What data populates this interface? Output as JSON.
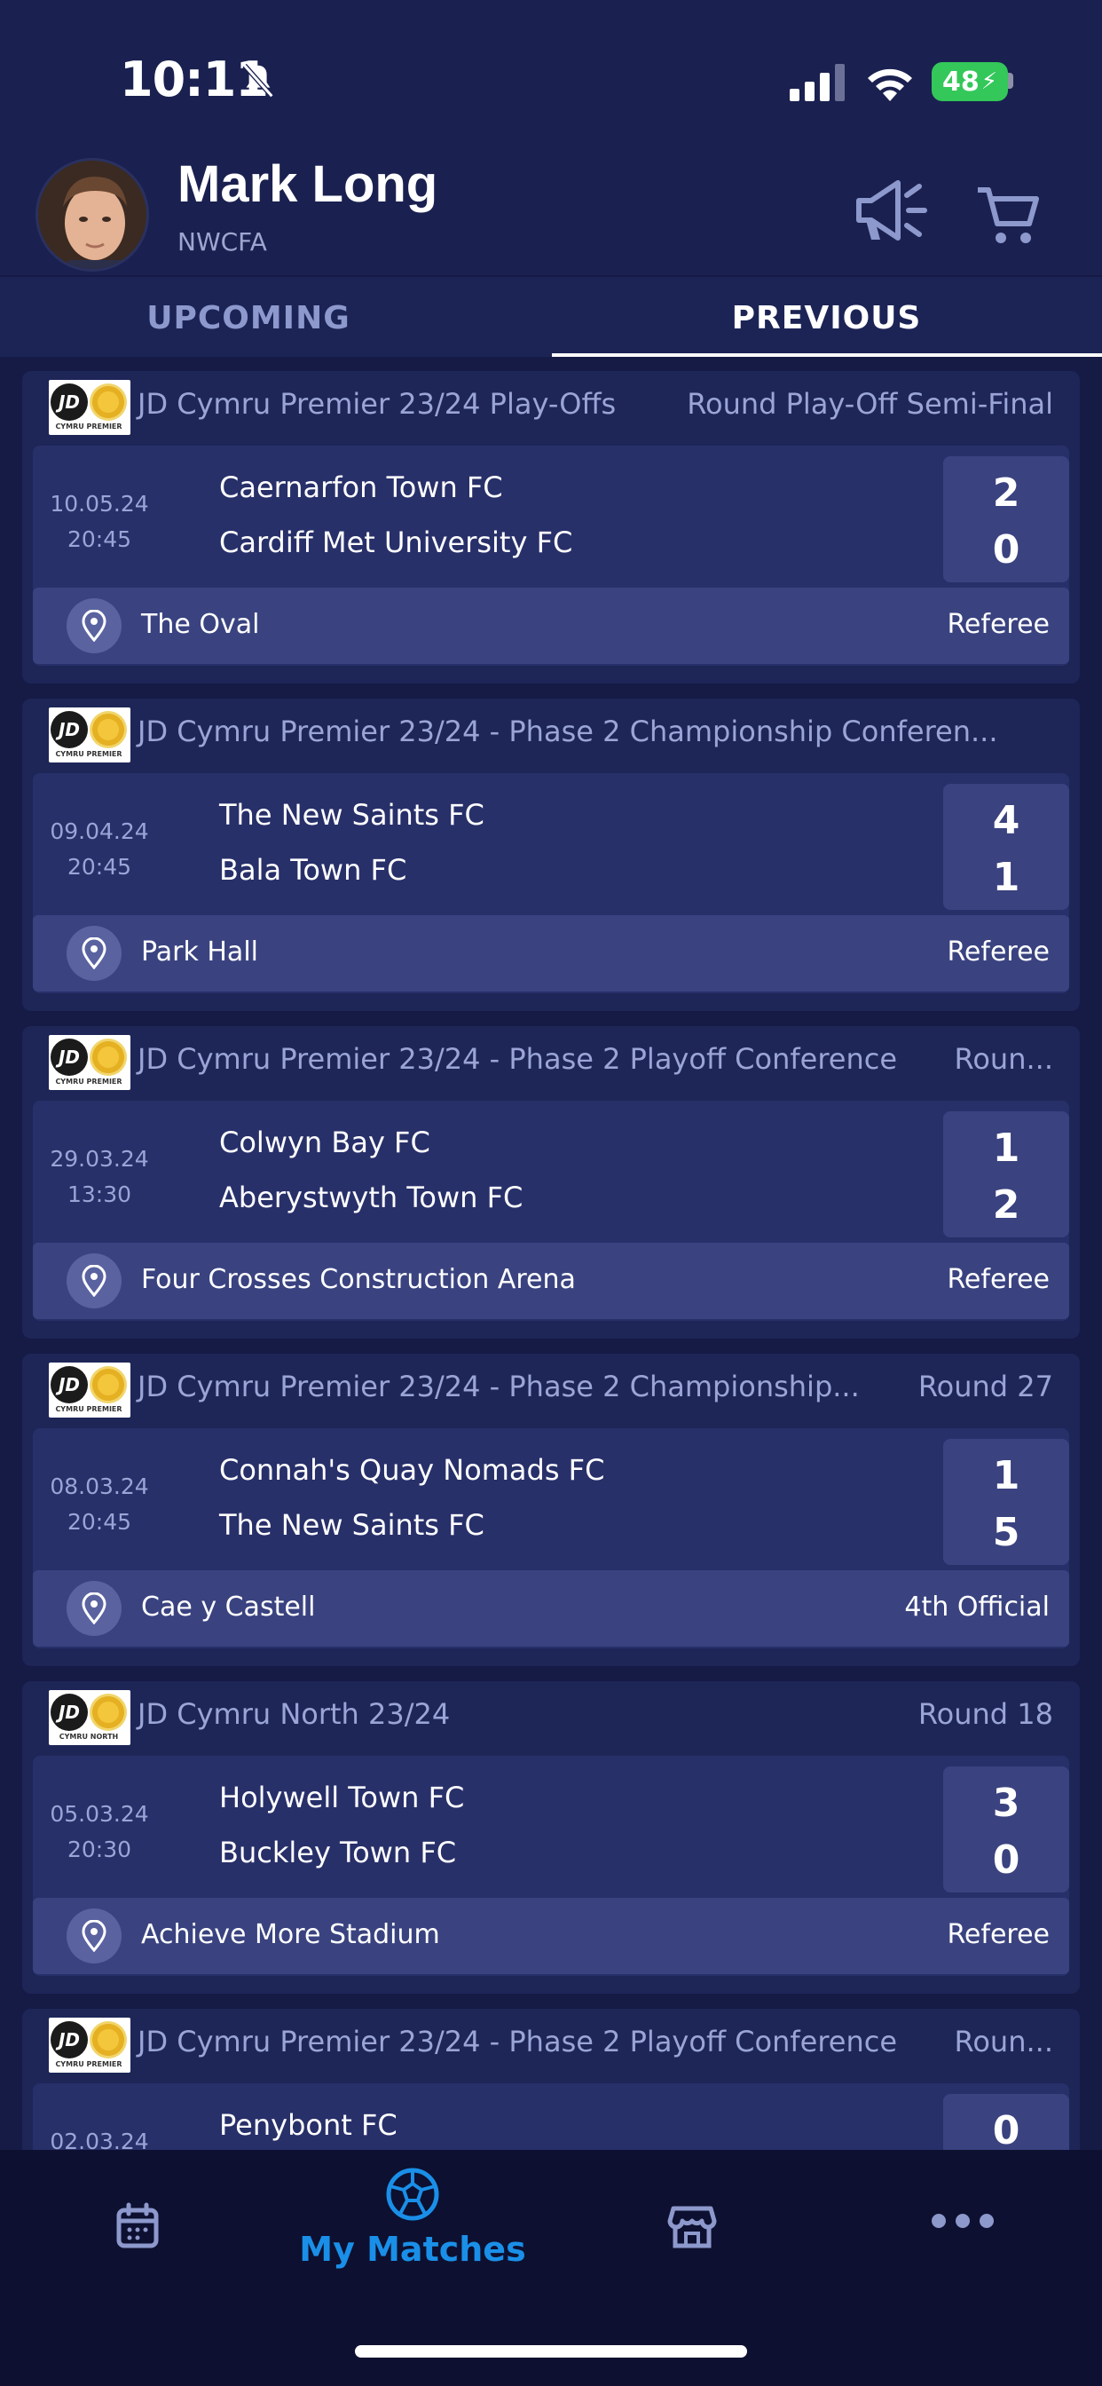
{
  "status_bar": {
    "time": "10:11",
    "battery": "48"
  },
  "header": {
    "user_name": "Mark Long",
    "organization": "NWCFA"
  },
  "tabs": [
    {
      "label": "UPCOMING",
      "active": false
    },
    {
      "label": "PREVIOUS",
      "active": true
    }
  ],
  "matches": [
    {
      "competition": "JD Cymru Premier 23/24 Play-Offs",
      "round": "Round Play-Off Semi-Final",
      "date": "10.05.24",
      "time": "20:45",
      "home_team": "Caernarfon Town FC",
      "away_team": "Cardiff Met University FC",
      "home_score": "2",
      "away_score": "0",
      "venue": "The Oval",
      "role": "Referee",
      "logo_sub": "CYMRU PREMIER"
    },
    {
      "competition": "JD Cymru Premier 23/24 - Phase 2 Championship Conferen...",
      "round": "",
      "date": "09.04.24",
      "time": "20:45",
      "home_team": "The New Saints FC",
      "away_team": "Bala Town FC",
      "home_score": "4",
      "away_score": "1",
      "venue": "Park Hall",
      "role": "Referee",
      "logo_sub": "CYMRU PREMIER"
    },
    {
      "competition": "JD Cymru Premier 23/24 - Phase 2 Playoff Conference",
      "round": "Roun...",
      "date": "29.03.24",
      "time": "13:30",
      "home_team": "Colwyn Bay FC",
      "away_team": "Aberystwyth Town FC",
      "home_score": "1",
      "away_score": "2",
      "venue": "Four Crosses Construction Arena",
      "role": "Referee",
      "logo_sub": "CYMRU PREMIER"
    },
    {
      "competition": "JD Cymru Premier 23/24 - Phase 2 Championship...",
      "round": "Round 27",
      "date": "08.03.24",
      "time": "20:45",
      "home_team": "Connah's Quay Nomads FC",
      "away_team": "The New Saints FC",
      "home_score": "1",
      "away_score": "5",
      "venue": "Cae y Castell",
      "role": "4th Official",
      "logo_sub": "CYMRU PREMIER"
    },
    {
      "competition": "JD Cymru North 23/24",
      "round": "Round 18",
      "date": "05.03.24",
      "time": "20:30",
      "home_team": "Holywell Town FC",
      "away_team": "Buckley Town FC",
      "home_score": "3",
      "away_score": "0",
      "venue": "Achieve More Stadium",
      "role": "Referee",
      "logo_sub": "CYMRU NORTH"
    },
    {
      "competition": "JD Cymru Premier 23/24 - Phase 2 Playoff Conference",
      "round": "Roun...",
      "date": "02.03.24",
      "time": "",
      "home_team": "Penybont FC",
      "away_team": "",
      "home_score": "0",
      "away_score": "",
      "venue": "",
      "role": "",
      "logo_sub": "CYMRU PREMIER"
    }
  ],
  "bottom_nav": {
    "items": [
      {
        "icon": "calendar-icon",
        "label": ""
      },
      {
        "icon": "football-icon",
        "label": "My Matches",
        "active": true
      },
      {
        "icon": "shop-icon",
        "label": ""
      },
      {
        "icon": "more-icon",
        "label": ""
      }
    ]
  },
  "colors": {
    "background": "#1a2150",
    "card": "#1e2658",
    "match_box": "#28306a",
    "accent": "#1a8fe8",
    "battery": "#34c759"
  }
}
